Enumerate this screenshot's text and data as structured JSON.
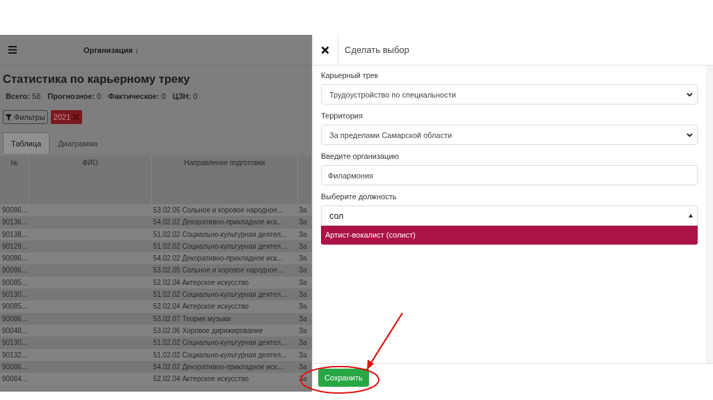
{
  "top_bar": {
    "title": "Организация ↓"
  },
  "page": {
    "title": "Статистика по карьерному треку",
    "stats": [
      {
        "label": "Всего:",
        "value": "58"
      },
      {
        "label": "Прогнозное:",
        "value": "0"
      },
      {
        "label": "Фактическое:",
        "value": "0"
      },
      {
        "label": "ЦЗН:",
        "value": "0"
      }
    ],
    "filters_button": "Фильтры",
    "filter_tag": "2021",
    "tabs": [
      {
        "label": "Таблица",
        "selected": true
      },
      {
        "label": "Диаграмма",
        "selected": false
      }
    ],
    "table": {
      "columns": [
        "№",
        "ФИО",
        "Направление подготовки"
      ],
      "rows": [
        {
          "number": "90086...",
          "direction": "53.02.05 Сольное и хоровое народное...",
          "column_4": "За"
        },
        {
          "number": "90136...",
          "direction": "54.02.02 Декоративно-прикладное иск...",
          "column_4": "За"
        },
        {
          "number": "90138...",
          "direction": "51.02.02 Социально-культурная деятел...",
          "column_4": "За"
        },
        {
          "number": "90129...",
          "direction": "51.02.02 Социально-культурная деятел...",
          "column_4": "За"
        },
        {
          "number": "90086...",
          "direction": "54.02.02 Декоративно-прикладное иск...",
          "column_4": "За"
        },
        {
          "number": "90086...",
          "direction": "53.02.05 Сольное и хоровое народное...",
          "column_4": "За"
        },
        {
          "number": "90085...",
          "direction": "52.02.04 Актерское искусство",
          "column_4": "За"
        },
        {
          "number": "90130...",
          "direction": "51.02.02 Социально-культурная деятел...",
          "column_4": "За"
        },
        {
          "number": "90085...",
          "direction": "52.02.04 Актерское искусство",
          "column_4": "За"
        },
        {
          "number": "90086...",
          "direction": "53.02.07 Теория музыки",
          "column_4": "За"
        },
        {
          "number": "90048...",
          "direction": "53.02.06 Хоровое дирижирование",
          "column_4": "За"
        },
        {
          "number": "90130...",
          "direction": "51.02.02 Социально-культурная деятел...",
          "column_4": "За"
        },
        {
          "number": "90132...",
          "direction": "51.02.02 Социально-культурная деятел...",
          "column_4": "За"
        },
        {
          "number": "90086...",
          "direction": "54.02.02 Декоративно-прикладное иск...",
          "column_4": "За"
        },
        {
          "number": "90084...",
          "direction": "52.02.04 Актерское искусство",
          "column_4": "За"
        }
      ]
    }
  },
  "drawer": {
    "title": "Сделать выбор",
    "fields": [
      {
        "kind": "select",
        "label": "Карьерный трек",
        "value": "Трудоустройство по специальности"
      },
      {
        "kind": "select",
        "label": "Территория",
        "value": "За пределами Самарской области"
      },
      {
        "kind": "input",
        "label": "Введите организацию",
        "value": "Филармония"
      },
      {
        "kind": "combobox",
        "label": "Выберите должность",
        "value": "сол",
        "options": [
          {
            "label": "Артист-вокалист (солист)",
            "selected": true
          }
        ]
      }
    ],
    "save_button": "Сохранить"
  }
}
